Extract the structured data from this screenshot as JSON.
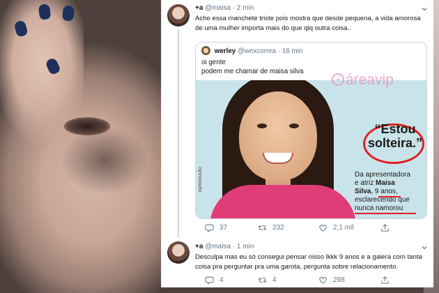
{
  "tweet1": {
    "display_name": "+a",
    "handle": "@maisa",
    "time": "2 min",
    "text_line1": "Acho essa manchete triste pois mostra que desde pequena, a vida amorosa",
    "text_line2": "de uma mulher importa mais do que qlq outra coisa..",
    "quoted": {
      "display_name": "werley",
      "handle": "@wexcorrea",
      "time": "16 min",
      "text_line1": "oi gente",
      "text_line2": "podem me chamar de maisa silva",
      "image": {
        "headline_line1": "“Estou",
        "headline_line2": "solteira.”",
        "caption_line1": "Da apresentadora",
        "caption_line2a": "e atriz ",
        "caption_line2b": "Maisa",
        "caption_line3a": "Silva",
        "caption_line3b": ", 9 anos,",
        "caption_line4": "esclarecendo que",
        "caption_line5": "nunca namorou",
        "credit": "REPRODUÇÃO"
      }
    },
    "actions": {
      "replies": "37",
      "retweets": "232",
      "likes": "2,1 mil"
    }
  },
  "tweet2": {
    "display_name": "+a",
    "handle": "@maisa",
    "time": "1 min",
    "text_line1": "Desculpa mas eu só consegui pensar nisso lkkk 9 anos e a galera com tanta",
    "text_line2": "coisa pra perguntar pra uma garota, pergunta sobre relacionamento.",
    "actions": {
      "replies": "4",
      "retweets": "4",
      "likes": "298"
    }
  },
  "watermark": "áreavip",
  "colors": {
    "text": "#14171a",
    "muted": "#657786",
    "border": "#ccd6dd",
    "watermark": "#eb8cb9",
    "headline_ring": "#e02020"
  }
}
